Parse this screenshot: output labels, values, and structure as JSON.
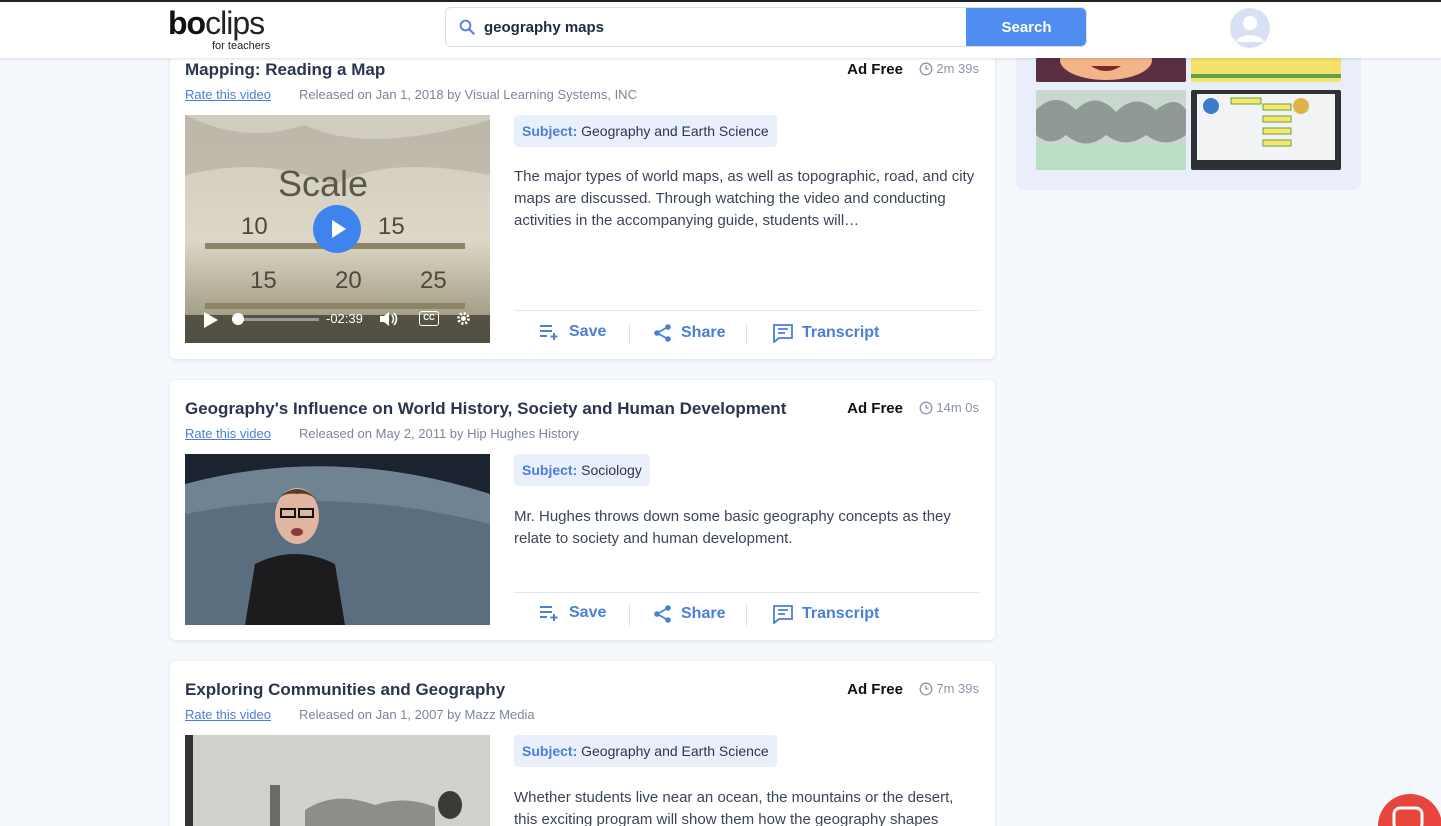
{
  "header": {
    "logo_bo": "bo",
    "logo_clips": "clips",
    "logo_sub": "for teachers",
    "search_value": "geography maps",
    "search_button": "Search"
  },
  "results": [
    {
      "title": "Mapping: Reading a Map",
      "ad_free": "Ad Free",
      "duration": "2m 39s",
      "rate": "Rate this video",
      "released": "Released on Jan 1, 2018 by Visual Learning Systems, INC",
      "subject_label": "Subject:",
      "subject": "Geography and Earth Science",
      "description": "The major types of world maps, as well as topographic, road, and city maps are discussed. Through watching the video and conducting activities in the accompanying guide, students will…",
      "player": {
        "scale_text": "Scale",
        "n1": "10",
        "n2": "15",
        "n3": "15",
        "n4": "20",
        "n5": "25",
        "time": "-02:39",
        "cc": "CC"
      }
    },
    {
      "title": "Geography's Influence on World History, Society and Human Development",
      "ad_free": "Ad Free",
      "duration": "14m 0s",
      "rate": "Rate this video",
      "released": "Released on May 2, 2011 by Hip Hughes History",
      "subject_label": "Subject:",
      "subject": "Sociology",
      "description": "Mr. Hughes throws down some basic geography concepts as they relate to society and human development."
    },
    {
      "title": "Exploring Communities and Geography",
      "ad_free": "Ad Free",
      "duration": "7m 39s",
      "rate": "Rate this video",
      "released": "Released on Jan 1, 2007 by Mazz Media",
      "subject_label": "Subject:",
      "subject": "Geography and Earth Science",
      "description": "Whether students live near an ocean, the mountains or the desert, this exciting program will show them how the geography shapes"
    }
  ],
  "actions": {
    "save": "Save",
    "share": "Share",
    "transcript": "Transcript"
  },
  "colors": {
    "accent": "#4f8ef0",
    "link": "#4a7fd8",
    "background": "#f5f8fd",
    "fab": "#e8453c"
  },
  "icons": [
    "search-icon",
    "user-icon",
    "clock-icon",
    "playlist-add-icon",
    "share-icon",
    "transcript-icon",
    "play-icon",
    "volume-icon",
    "captions-icon",
    "gear-icon"
  ]
}
